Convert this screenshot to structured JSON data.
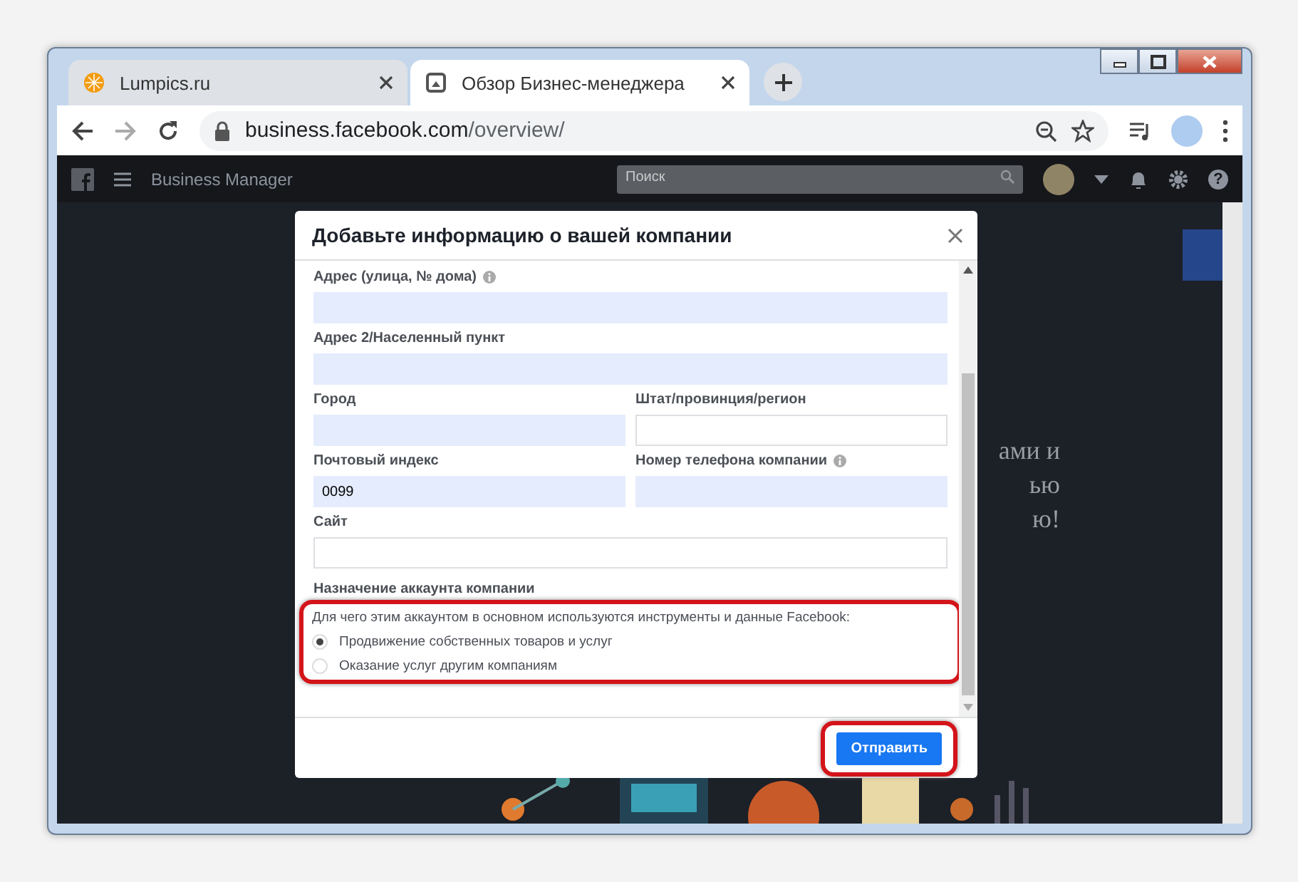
{
  "tabs": [
    {
      "title": "Lumpics.ru",
      "selected": false
    },
    {
      "title": "Обзор Бизнес-менеджера",
      "selected": true
    }
  ],
  "address_bar": {
    "host": "business.facebook.com",
    "path": "/overview/"
  },
  "app_header": {
    "title": "Business Manager",
    "search_placeholder": "Поиск",
    "help_glyph": "?"
  },
  "background_text": [
    "ами и",
    "ью",
    "ю!"
  ],
  "dialog": {
    "title": "Добавьте информацию о вашей компании",
    "rows": [
      {
        "fields": [
          {
            "label": "Адрес (улица, № дома)",
            "filled": true,
            "info": true
          }
        ]
      },
      {
        "fields": [
          {
            "label": "Адрес 2/Населенный пункт",
            "filled": true,
            "info": false
          }
        ]
      },
      {
        "fields": [
          {
            "label": "Город",
            "filled": true,
            "info": false
          },
          {
            "label": "Штат/провинция/регион",
            "filled": false,
            "info": false
          }
        ]
      },
      {
        "fields": [
          {
            "label": "Почтовый индекс",
            "value": "0099",
            "filled": true,
            "info": false
          },
          {
            "label": "Номер телефона компании",
            "filled": true,
            "info": true
          }
        ]
      },
      {
        "fields": [
          {
            "label": "Сайт",
            "filled": false,
            "info": false
          }
        ]
      }
    ],
    "purpose": {
      "heading": "Назначение аккаунта компании",
      "question": "Для чего этим аккаунтом в основном используются инструменты и данные Facebook:",
      "highlighted": true,
      "options": [
        {
          "label": "Продвижение собственных товаров и услуг",
          "selected": true
        },
        {
          "label": "Оказание услуг другим компаниям",
          "selected": false
        }
      ]
    },
    "submit": {
      "label": "Отправить",
      "highlighted": true
    }
  }
}
